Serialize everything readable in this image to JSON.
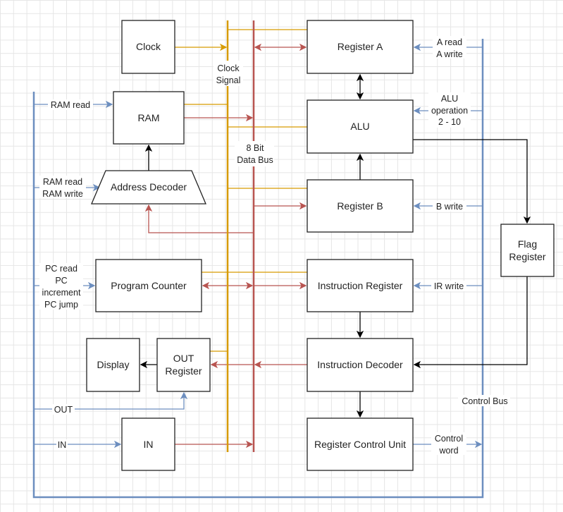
{
  "colors": {
    "clock_signal": "#d79b00",
    "data_bus": "#b85450",
    "control_bus": "#6c8ebf",
    "internal": "#000000"
  },
  "blocks": {
    "clock": "Clock",
    "ram": "RAM",
    "address_decoder": "Address Decoder",
    "program_counter": "Program Counter",
    "display": "Display",
    "out_register": [
      "OUT",
      "Register"
    ],
    "in": "IN",
    "register_a": "Register A",
    "alu": "ALU",
    "register_b": "Register B",
    "instruction_register": "Instruction Register",
    "instruction_decoder": "Instruction Decoder",
    "register_control_unit": "Register Control Unit",
    "flag_register": [
      "Flag",
      "Register"
    ]
  },
  "bus_labels": {
    "clock_signal": [
      "Clock",
      "Signal"
    ],
    "data_bus": [
      "8 Bit",
      "Data Bus"
    ],
    "control_bus": "Control Bus"
  },
  "signals": {
    "ram_read": "RAM read",
    "ram_read_write": [
      "RAM read",
      "RAM write"
    ],
    "pc": [
      "PC read",
      "PC",
      "increment",
      "PC jump"
    ],
    "out": "OUT",
    "in": "IN",
    "a_read_write": [
      "A read",
      "A write"
    ],
    "alu_op": [
      "ALU",
      "operation",
      "2 - 10"
    ],
    "b_write": "B write",
    "ir_write": "IR write",
    "control_word": [
      "Control",
      "word"
    ]
  }
}
